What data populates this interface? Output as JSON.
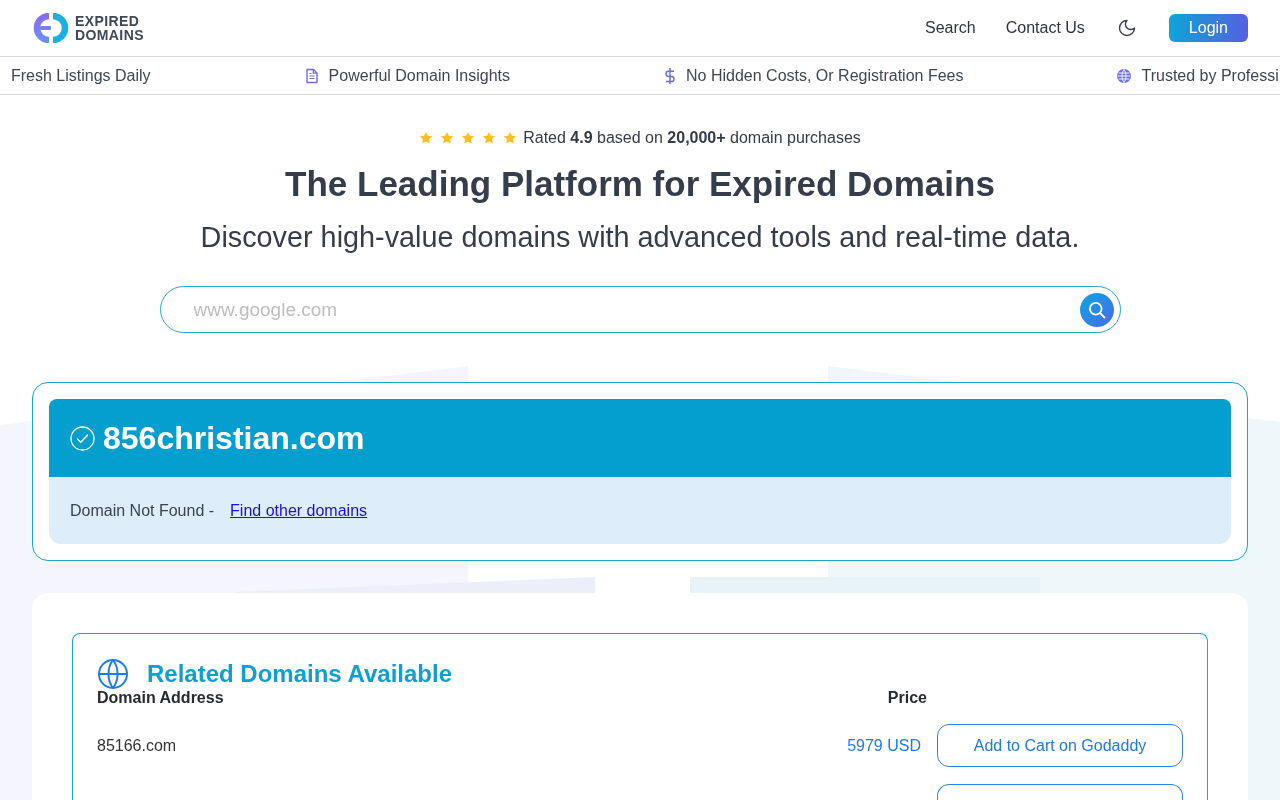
{
  "header": {
    "logo": {
      "line_1": "EXPIRED",
      "line_2": "DOMAINS"
    },
    "nav_links": [
      "Search",
      "Contact Us"
    ],
    "login_button": "Login"
  },
  "ticker": [
    {
      "label": "Fresh Listings Daily"
    },
    {
      "label": "Powerful Domain Insights"
    },
    {
      "label": "No Hidden Costs, Or Registration Fees"
    },
    {
      "label": "Trusted by Professi"
    }
  ],
  "hero": {
    "rating": {
      "stars": 5,
      "text": "Rated **4.9** based on **20,000+** domain purchases"
    },
    "title": "The Leading Platform for Expired Domains",
    "subtitle": "Discover high-value domains with advanced tools and real-time data.",
    "search": {
      "placeholder": "www.google.com"
    }
  },
  "result": {
    "domain": "856christian.com",
    "status": "Domain Not Found -",
    "link": "Find other domains"
  },
  "related": {
    "title": "Related Domains Available",
    "columns": [
      "Domain Address",
      "Price"
    ],
    "rows": [
      {
        "kind": "full",
        "domain": "85166.com",
        "price": "5979 USD",
        "action": "Add to Cart on Godaddy"
      },
      {
        "kind": "cut"
      }
    ]
  }
}
